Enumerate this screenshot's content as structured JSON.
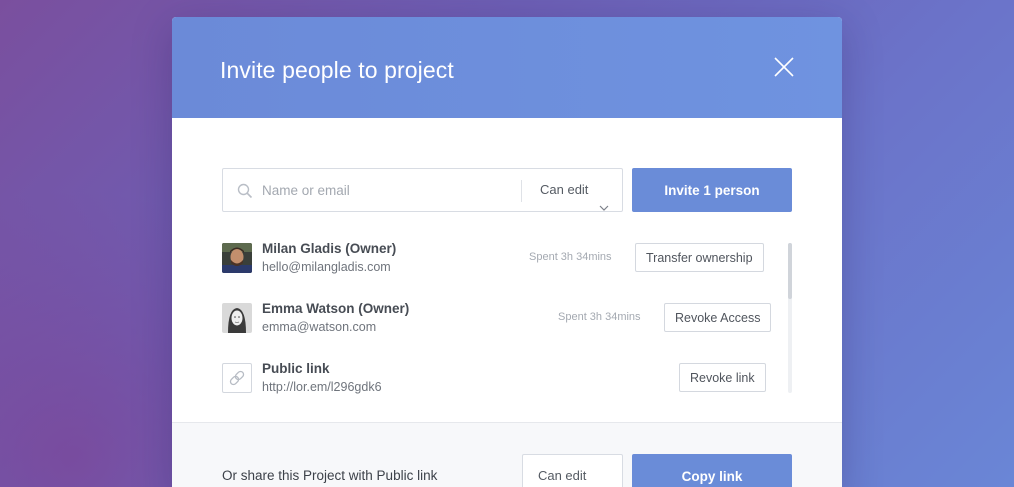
{
  "modal": {
    "title": "Invite people to project"
  },
  "invite": {
    "placeholder": "Name or email",
    "value": "",
    "permission": "Can edit",
    "button_label": "Invite 1 person"
  },
  "members": [
    {
      "name": "Milan Gladis (Owner)",
      "email": "hello@milangladis.com",
      "spent": "Spent 3h 34mins",
      "action": "Transfer ownership",
      "avatar": "person-photo"
    },
    {
      "name": "Emma Watson (Owner)",
      "email": "emma@watson.com",
      "spent": "Spent 3h 34mins",
      "action": "Revoke Access",
      "avatar": "person-photo"
    },
    {
      "name": "Public link",
      "email": "http://lor.em/l296gdk6",
      "action": "Revoke link",
      "avatar": "link-icon"
    }
  ],
  "footer": {
    "text": "Or share this Project with Public link",
    "permission": "Can edit",
    "button_label": "Copy link"
  },
  "icons": {
    "close": "close-icon",
    "search": "search-icon",
    "dropdown": "chevron-down-icon",
    "link": "link-icon"
  },
  "colors": {
    "accent": "#6a8cd8",
    "header": "#6f8fdc",
    "background_start": "#7a4f9e",
    "background_end": "#6a86d6"
  }
}
